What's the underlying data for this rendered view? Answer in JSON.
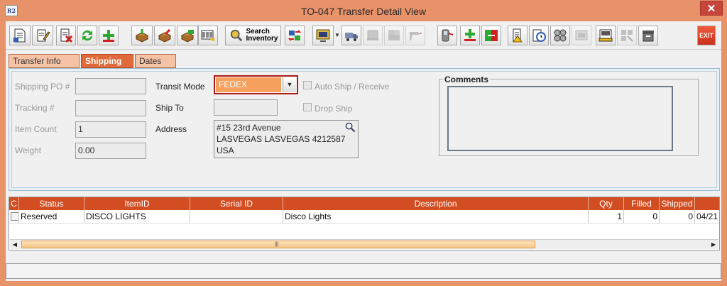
{
  "window": {
    "title": "TO-047 Transfer Detail View",
    "app_icon_text": "R2",
    "close_glyph": "✕"
  },
  "toolbar": {
    "buttons": [
      {
        "name": "new-document-icon"
      },
      {
        "name": "edit-document-icon"
      },
      {
        "name": "delete-document-icon"
      },
      {
        "name": "refresh-icon"
      },
      {
        "name": "add-icon"
      },
      {
        "name": "receive-box-icon"
      },
      {
        "name": "ship-box-icon"
      },
      {
        "name": "print-box-icon"
      },
      {
        "name": "barcode-icon"
      },
      {
        "name": "search-inventory-icon",
        "line1": "Search",
        "line2": "Inventory"
      },
      {
        "name": "transfer-icon"
      },
      {
        "name": "display-icon"
      },
      {
        "name": "truck-icon"
      },
      {
        "name": "pallet-icon"
      },
      {
        "name": "pallet-stack-icon"
      },
      {
        "name": "scanner-icon"
      },
      {
        "name": "handheld-scanner-icon"
      },
      {
        "name": "split-add-icon"
      },
      {
        "name": "swap-icon"
      },
      {
        "name": "warning-doc-icon"
      },
      {
        "name": "schedule-icon"
      },
      {
        "name": "group-icon"
      },
      {
        "name": "disabled-window-icon"
      },
      {
        "name": "print-preview-icon"
      },
      {
        "name": "grid-select-icon"
      },
      {
        "name": "archive-icon"
      }
    ],
    "exit_label": "EXIT"
  },
  "tabs": [
    {
      "label": "Transfer Info",
      "active": false
    },
    {
      "label": "Shipping",
      "active": true
    },
    {
      "label": "Dates",
      "active": false
    }
  ],
  "shipping": {
    "shipping_po_label": "Shipping PO #",
    "shipping_po_value": "",
    "tracking_label": "Tracking #",
    "tracking_value": "",
    "item_count_label": "Item Count",
    "item_count_value": "1",
    "weight_label": "Weight",
    "weight_value": "0.00",
    "transit_mode_label": "Transit Mode",
    "transit_mode_value": "FEDEX",
    "ship_to_label": "Ship To",
    "ship_to_value": "",
    "address_label": "Address",
    "address_lines": [
      "#15 23rd Avenue",
      "LASVEGAS LASVEGAS 4212587",
      "USA"
    ],
    "auto_ship_label": "Auto Ship / Receive",
    "auto_ship_checked": false,
    "drop_ship_label": "Drop Ship",
    "drop_ship_checked": false,
    "comments_label": "Comments",
    "comments_value": ""
  },
  "grid": {
    "columns": [
      "C",
      "Status",
      "ItemID",
      "Serial ID",
      "Description",
      "Qty",
      "Filled",
      "Shipped"
    ],
    "rows": [
      {
        "status": "Reserved",
        "item_id": "DISCO LIGHTS",
        "serial_id": "",
        "description": "Disco Lights",
        "qty": "1",
        "filled": "0",
        "shipped": "0",
        "date": "04/21"
      }
    ]
  },
  "colors": {
    "chrome": "#e8926a",
    "accent": "#d24e22",
    "active_tab": "#e06a3a",
    "combo_highlight": "#f5a05c"
  }
}
